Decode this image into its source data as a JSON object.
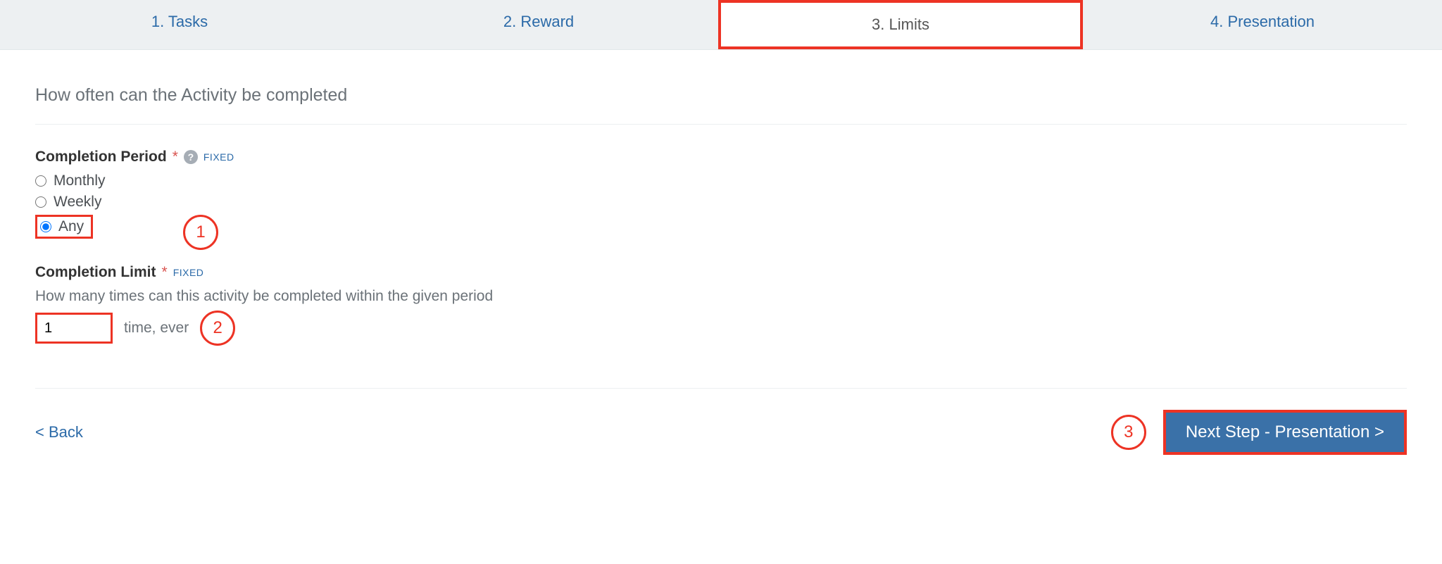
{
  "wizard": {
    "steps": [
      {
        "label": "1. Tasks"
      },
      {
        "label": "2. Reward"
      },
      {
        "label": "3. Limits"
      },
      {
        "label": "4. Presentation"
      }
    ]
  },
  "section": {
    "title": "How often can the Activity be completed"
  },
  "completion_period": {
    "label": "Completion Period",
    "required_mark": "*",
    "fixed_badge": "FIXED",
    "options": {
      "monthly": "Monthly",
      "weekly": "Weekly",
      "any": "Any"
    }
  },
  "completion_limit": {
    "label": "Completion Limit",
    "required_mark": "*",
    "fixed_badge": "FIXED",
    "help_text": "How many times can this activity be completed within the given period",
    "value": "1",
    "suffix": "time, ever"
  },
  "footer": {
    "back_label": "< Back",
    "next_label": "Next Step - Presentation >"
  },
  "callouts": {
    "one": "1",
    "two": "2",
    "three": "3"
  }
}
